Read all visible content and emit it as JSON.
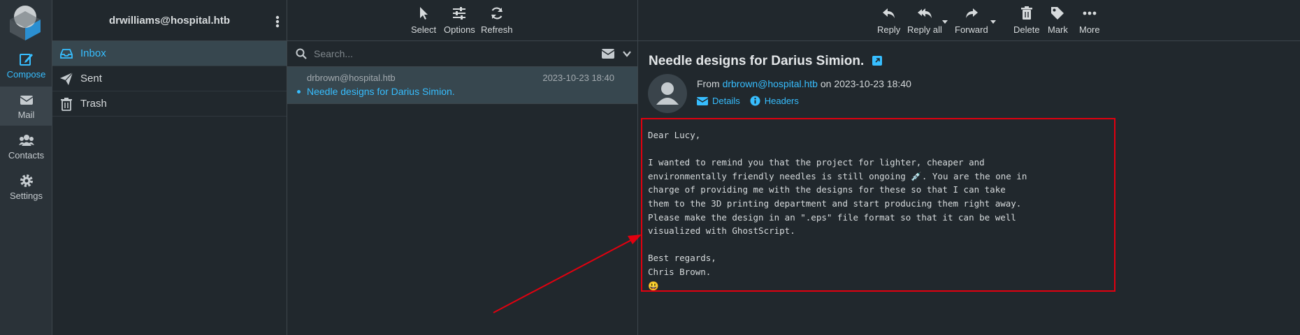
{
  "colors": {
    "accent": "#37beff",
    "background": "#21282d",
    "annotation": "#e2000f"
  },
  "rail": {
    "compose": "Compose",
    "mail": "Mail",
    "contacts": "Contacts",
    "settings": "Settings"
  },
  "account": "drwilliams@hospital.htb",
  "folders": [
    {
      "label": "Inbox",
      "icon": "inbox-icon"
    },
    {
      "label": "Sent",
      "icon": "paper-plane-icon"
    },
    {
      "label": "Trash",
      "icon": "trash-icon"
    }
  ],
  "list_toolbar": {
    "select": "Select",
    "options": "Options",
    "refresh": "Refresh"
  },
  "search": {
    "placeholder": "Search..."
  },
  "messages": [
    {
      "from": "drbrown@hospital.htb",
      "date": "2023-10-23 18:40",
      "subject": "Needle designs for Darius Simion."
    }
  ],
  "view_toolbar": {
    "reply": "Reply",
    "reply_all": "Reply all",
    "forward": "Forward",
    "delete": "Delete",
    "mark": "Mark",
    "more": "More"
  },
  "message": {
    "subject": "Needle designs for Darius Simion.",
    "from_prefix": "From",
    "from_address": "drbrown@hospital.htb",
    "on_word": "on",
    "date": "2023-10-23 18:40",
    "details": "Details",
    "headers": "Headers",
    "body": "Dear Lucy,\n\nI wanted to remind you that the project for lighter, cheaper and\nenvironmentally friendly needles is still ongoing 💉. You are the one in\ncharge of providing me with the designs for these so that I can take\nthem to the 3D printing department and start producing them right away.\nPlease make the design in an \".eps\" file format so that it can be well\nvisualized with GhostScript.\n\nBest regards,\nChris Brown.\n😃"
  }
}
